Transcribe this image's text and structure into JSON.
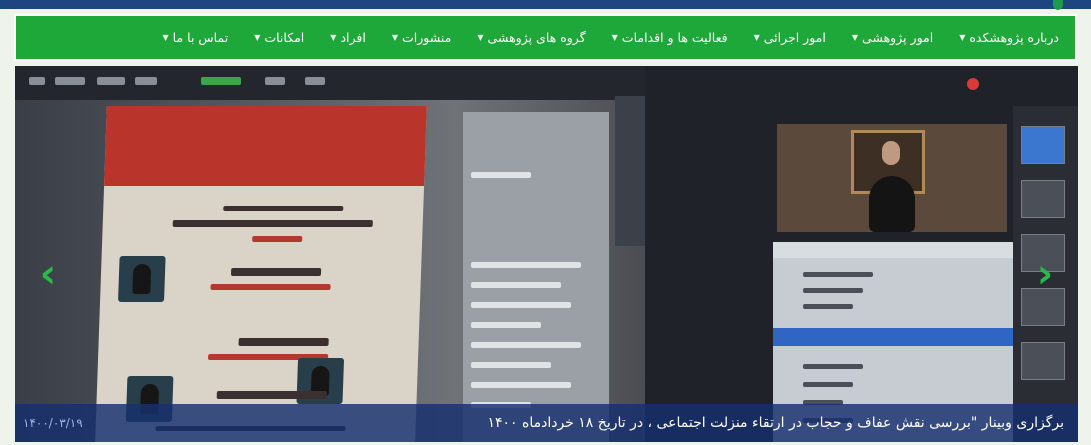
{
  "nav": {
    "items": [
      {
        "label": "درباره پژوهشکده"
      },
      {
        "label": "امور پژوهشی"
      },
      {
        "label": "امور اجرائی"
      },
      {
        "label": "فعالیت ها و اقدامات"
      },
      {
        "label": "گروه های پژوهشی"
      },
      {
        "label": "منشورات"
      },
      {
        "label": "افراد"
      },
      {
        "label": "امکانات"
      },
      {
        "label": "تماس با ما"
      }
    ]
  },
  "slider": {
    "caption": "برگزاری وبینار \"بررسی نقش عفاف و حجاب در ارتقاء منزلت اجتماعی ، در تاریخ ۱۸ خردادماه ۱۴۰۰",
    "date": "۱۴۰۰/۰۳/۱۹",
    "prev_icon": "chevron-left-icon",
    "next_icon": "chevron-right-icon"
  },
  "colors": {
    "nav_bg": "#1fa83a",
    "top_strip": "#1d4580",
    "caption_bg": "#16306e",
    "arrow": "#29b84a"
  }
}
